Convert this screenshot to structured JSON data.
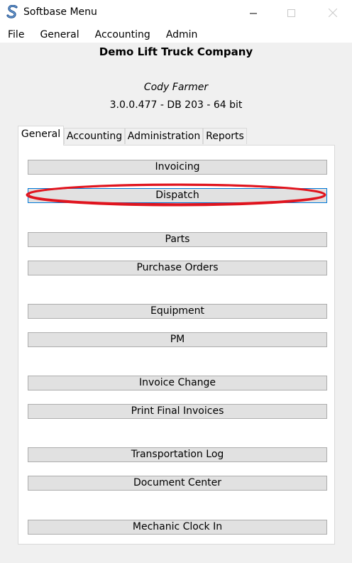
{
  "window": {
    "title": "Softbase Menu",
    "controls": {
      "minimize": "minimize",
      "maximize": "maximize",
      "close": "close"
    }
  },
  "menubar": {
    "items": [
      "File",
      "General",
      "Accounting",
      "Admin"
    ]
  },
  "header": {
    "company": "Demo Lift Truck Company",
    "user": "Cody Farmer",
    "version": "3.0.0.477 - DB 203 - 64 bit"
  },
  "tabs": [
    {
      "label": "General",
      "active": true
    },
    {
      "label": "Accounting",
      "active": false
    },
    {
      "label": "Administration",
      "active": false
    },
    {
      "label": "Reports",
      "active": false
    }
  ],
  "buttons": {
    "invoicing": "Invoicing",
    "dispatch": "Dispatch",
    "parts": "Parts",
    "purchase_orders": "Purchase Orders",
    "equipment": "Equipment",
    "pm": "PM",
    "invoice_change": "Invoice Change",
    "print_final_invoices": "Print Final Invoices",
    "transportation_log": "Transportation Log",
    "document_center": "Document Center",
    "mechanic_clock_in": "Mechanic Clock In"
  },
  "annotation": {
    "color": "#e0141e",
    "target": "dispatch"
  }
}
